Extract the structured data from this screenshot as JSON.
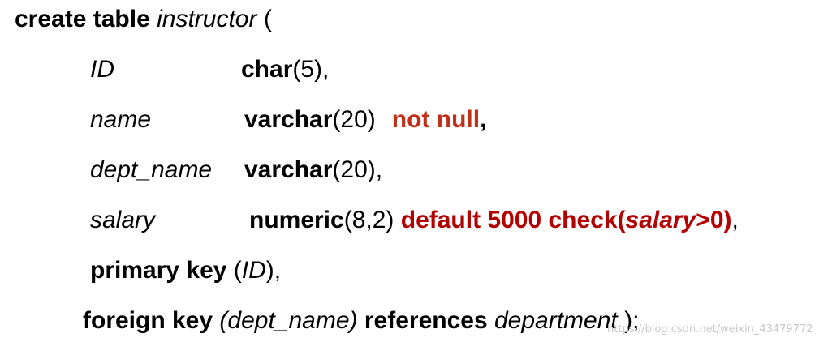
{
  "sql": {
    "line1": {
      "kw": "create table",
      "table": "instructor",
      "paren": " ("
    },
    "line2": {
      "col": "ID",
      "type": "char",
      "args": "(5),"
    },
    "line3": {
      "col": "name",
      "type": "varchar",
      "args": "(20)",
      "constraint": "not null",
      "comma": ","
    },
    "line4": {
      "col": "dept_name",
      "type": "varchar",
      "args": "(20),"
    },
    "line5": {
      "col": "salary",
      "type": "numeric",
      "args": "(8,2)",
      "default_kw": "default 5000 check(",
      "check_col": "salary",
      "check_rest": ">0)",
      "comma": ","
    },
    "line6": {
      "kw": "primary key",
      "open": " (",
      "col": "ID",
      "close": "),"
    },
    "line7": {
      "kw": "foreign key",
      "col": "(dept_name)",
      "ref_kw": "references",
      "ref_table": "department",
      "close": " );"
    }
  },
  "watermark": "https://blog.csdn.net/weixin_43479772",
  "colors": {
    "text": "#000000",
    "not_null": "#c0311a",
    "default_check": "#b30000"
  }
}
